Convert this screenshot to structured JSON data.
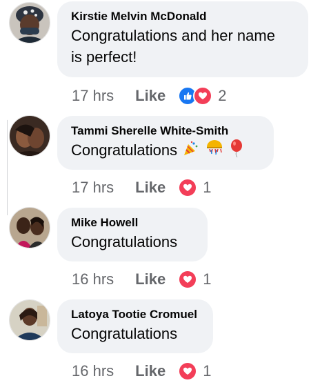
{
  "comments": [
    {
      "author": "Kirstie Melvin McDonald",
      "line1": "Congratulations and her name",
      "line2": "is perfect!",
      "time": "17 hrs",
      "like": "Like",
      "reactions": [
        "like-icon",
        "love-icon"
      ],
      "count": "2"
    },
    {
      "author": "Tammi Sherelle White-Smith",
      "line1": "Congratulations",
      "emojis": [
        "party-popper-emoji",
        "confetti-ball-emoji",
        "balloon-emoji"
      ],
      "time": "17 hrs",
      "like": "Like",
      "reactions": [
        "love-icon"
      ],
      "count": "1"
    },
    {
      "author": "Mike Howell",
      "line1": "Congratulations",
      "time": "16 hrs",
      "like": "Like",
      "reactions": [
        "love-icon"
      ],
      "count": "1"
    },
    {
      "author": "Latoya Tootie Cromuel",
      "line1": "Congratulations",
      "time": "16 hrs",
      "like": "Like",
      "reactions": [
        "love-icon"
      ],
      "count": "1"
    }
  ],
  "colors": {
    "bubble": "#f0f2f5",
    "meta_text": "#65676b",
    "like_reaction": "#1877f2",
    "love_reaction": "#f33e58"
  }
}
